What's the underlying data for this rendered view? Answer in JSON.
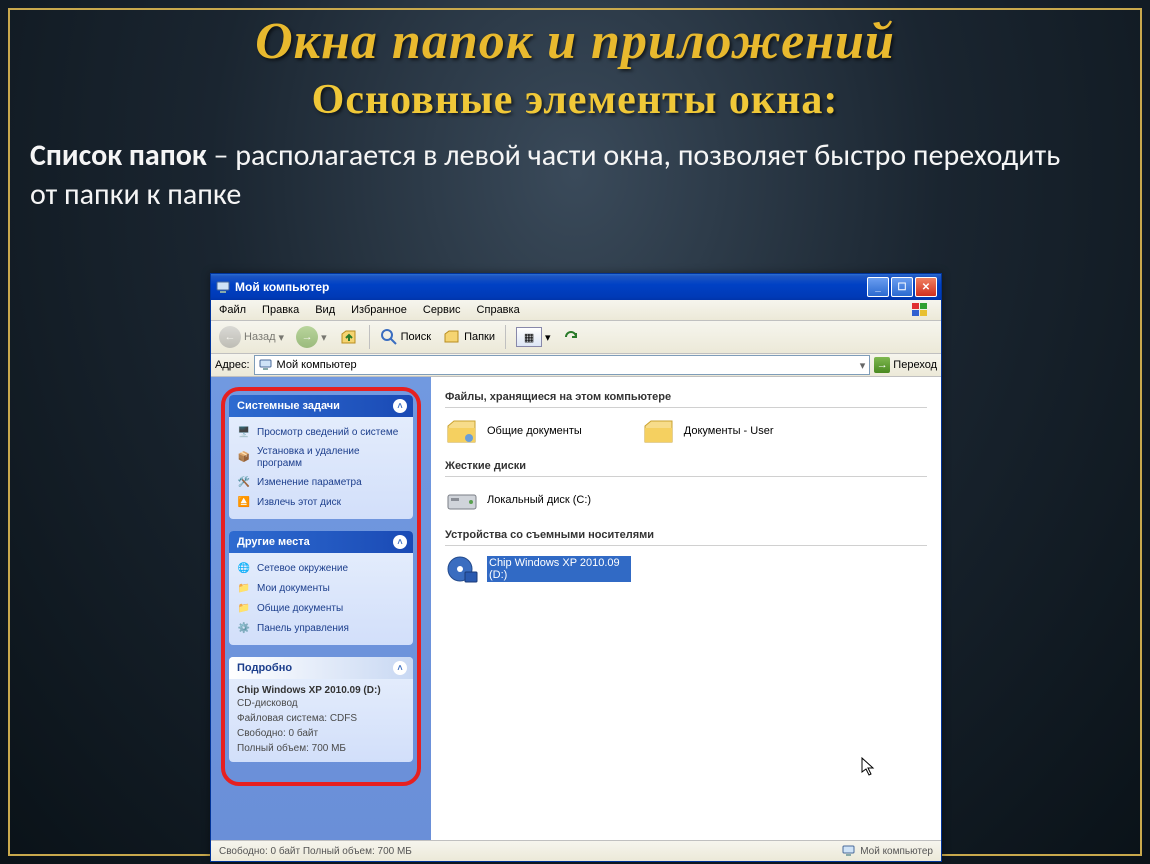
{
  "slide": {
    "title_main": "Окна папок и приложений",
    "title_sub": "Основные элементы окна:",
    "body_bold": "Список папок",
    "body_rest": " – располагается в левой части окна, позволяет быстро переходить от папки к папке"
  },
  "window": {
    "title": "Мой компьютер",
    "menubar": [
      "Файл",
      "Правка",
      "Вид",
      "Избранное",
      "Сервис",
      "Справка"
    ],
    "toolbar": {
      "back": "Назад",
      "search": "Поиск",
      "folders": "Папки"
    },
    "address_label": "Адрес:",
    "address_value": "Мой компьютер",
    "go_label": "Переход",
    "sidebar": {
      "panels": [
        {
          "header": "Системные задачи",
          "dark": true,
          "items": [
            {
              "label": "Просмотр сведений о системе"
            },
            {
              "label": "Установка и удаление программ"
            },
            {
              "label": "Изменение параметра"
            },
            {
              "label": "Извлечь этот диск"
            }
          ]
        },
        {
          "header": "Другие места",
          "dark": true,
          "items": [
            {
              "label": "Сетевое окружение"
            },
            {
              "label": "Мои документы"
            },
            {
              "label": "Общие документы"
            },
            {
              "label": "Панель управления"
            }
          ]
        },
        {
          "header": "Подробно",
          "dark": false,
          "details": {
            "title": "Chip Windows XP 2010.09 (D:)",
            "lines": [
              "CD-дисковод",
              "Файловая система: CDFS",
              "Свободно: 0 байт",
              "Полный объем: 700 МБ"
            ]
          }
        }
      ]
    },
    "content": {
      "sections": [
        {
          "header": "Файлы, хранящиеся на этом компьютере",
          "items": [
            {
              "label": "Общие документы",
              "type": "folder"
            },
            {
              "label": "Документы - User",
              "type": "folder"
            }
          ]
        },
        {
          "header": "Жесткие диски",
          "items": [
            {
              "label": "Локальный диск (C:)",
              "type": "hdd"
            }
          ]
        },
        {
          "header": "Устройства со съемными носителями",
          "items": [
            {
              "label": "Chip Windows XP 2010.09 (D:)",
              "type": "cd",
              "selected": true
            }
          ]
        }
      ]
    },
    "statusbar": {
      "left": "Свободно: 0 байт Полный объем: 700 МБ",
      "right": "Мой компьютер"
    }
  }
}
